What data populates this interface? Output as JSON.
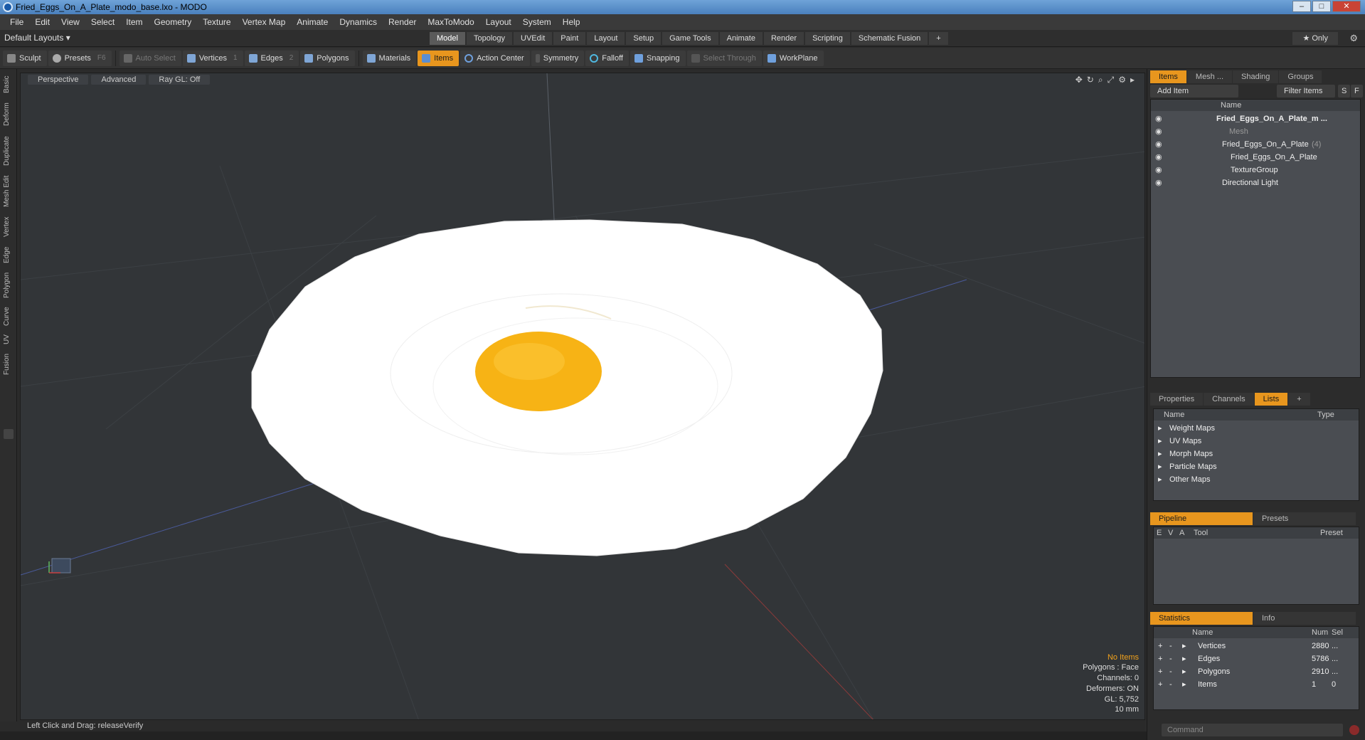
{
  "window": {
    "title": "Fried_Eggs_On_A_Plate_modo_base.lxo - MODO"
  },
  "menu": [
    "File",
    "Edit",
    "View",
    "Select",
    "Item",
    "Geometry",
    "Texture",
    "Vertex Map",
    "Animate",
    "Dynamics",
    "Render",
    "MaxToModo",
    "Layout",
    "System",
    "Help"
  ],
  "layout": {
    "selector": "Default Layouts ▾",
    "tabs": [
      "Model",
      "Topology",
      "UVEdit",
      "Paint",
      "Layout",
      "Setup",
      "Game Tools",
      "Animate",
      "Render",
      "Scripting",
      "Schematic Fusion",
      "+"
    ],
    "active_tab": "Model",
    "only_label": "★  Only"
  },
  "toolbar": {
    "sculpt": "Sculpt",
    "presets": "Presets",
    "presets_key": "F6",
    "auto_select": "Auto Select",
    "vertices": "Vertices",
    "vertices_key": "1",
    "edges": "Edges",
    "edges_key": "2",
    "polygons": "Polygons",
    "materials": "Materials",
    "items": "Items",
    "action_center": "Action Center",
    "symmetry": "Symmetry",
    "falloff": "Falloff",
    "snapping": "Snapping",
    "select_through": "Select Through",
    "workplane": "WorkPlane"
  },
  "left_tabs": [
    "Basic",
    "Deform",
    "Duplicate",
    "Mesh Edit",
    "Vertex",
    "Edge",
    "Polygon",
    "Curve",
    "UV",
    "Fusion"
  ],
  "viewport": {
    "view": "Perspective",
    "shading": "Advanced",
    "raygl": "Ray GL: Off",
    "info": {
      "no_items": "No Items",
      "polygons": "Polygons : Face",
      "channels": "Channels: 0",
      "deformers": "Deformers: ON",
      "gl": "GL: 5,752",
      "scale": "10 mm"
    }
  },
  "status": {
    "text": "Left Click and Drag:   releaseVerify"
  },
  "items_panel": {
    "tabs": [
      "Items",
      "Mesh ...",
      "Shading",
      "Groups"
    ],
    "add_item": "Add Item",
    "filter": "Filter Items",
    "s": "S",
    "f": "F",
    "col_name": "Name",
    "tree": [
      {
        "label": "Fried_Eggs_On_A_Plate_m ...",
        "bold": true
      },
      {
        "label": "Mesh",
        "dim": true
      },
      {
        "label": "Fried_Eggs_On_A_Plate",
        "count": "(4)"
      },
      {
        "label": "Fried_Eggs_On_A_Plate"
      },
      {
        "label": "TextureGroup"
      },
      {
        "label": "Directional Light"
      }
    ]
  },
  "lists_panel": {
    "tabs": [
      "Properties",
      "Channels",
      "Lists",
      "+"
    ],
    "col_name": "Name",
    "col_type": "Type",
    "rows": [
      "Weight Maps",
      "UV Maps",
      "Morph Maps",
      "Particle Maps",
      "Other Maps"
    ]
  },
  "pipeline_panel": {
    "tabs": [
      "Pipeline",
      "Presets"
    ],
    "cols": [
      "E",
      "V",
      "A",
      "Tool",
      "Preset"
    ]
  },
  "stats_panel": {
    "tabs": [
      "Statistics",
      "Info"
    ],
    "cols": [
      "Name",
      "Num",
      "Sel"
    ],
    "rows": [
      {
        "name": "Vertices",
        "num": "2880",
        "sel": "..."
      },
      {
        "name": "Edges",
        "num": "5786",
        "sel": "..."
      },
      {
        "name": "Polygons",
        "num": "2910",
        "sel": "..."
      },
      {
        "name": "Items",
        "num": "1",
        "sel": "0"
      }
    ]
  },
  "command": {
    "placeholder": "Command"
  },
  "colors": {
    "accent": "#e8961e",
    "yolk": "#f7b315",
    "plate": "#ffffff",
    "viewport_bg": "#323538"
  }
}
